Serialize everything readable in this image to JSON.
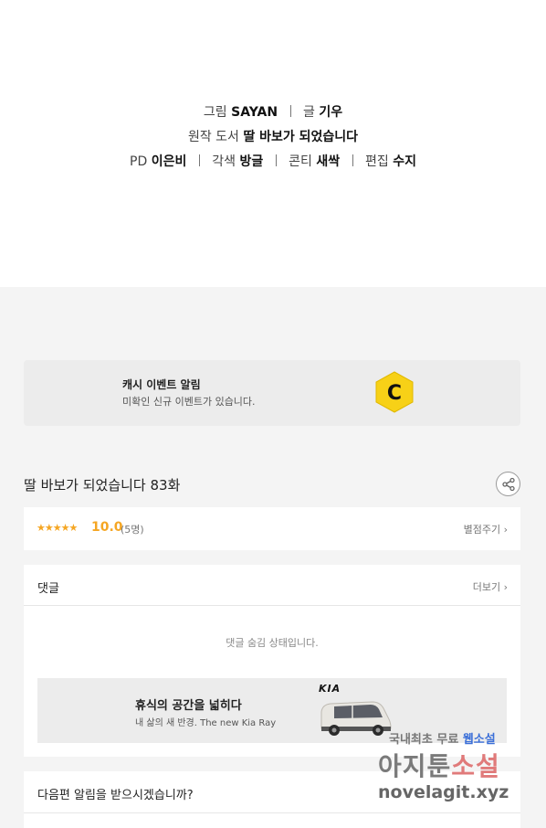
{
  "credits": {
    "art_label": "그림",
    "art_value": "SAYAN",
    "story_label": "글",
    "story_value": "기우",
    "original_label": "원작 도서",
    "original_value": "딸 바보가 되었습니다",
    "pd_label": "PD",
    "pd_value": "이은비",
    "adapt_label": "각색",
    "adapt_value": "방글",
    "storyboard_label": "콘티",
    "storyboard_value": "새싹",
    "edit_label": "편집",
    "edit_value": "수지"
  },
  "event_banner": {
    "title": "캐시 이벤트 알림",
    "subtitle": "미확인 신규 이벤트가 있습니다.",
    "icon": "cash-coin-icon",
    "coin_letter": "C",
    "coin_color": "#f7d117"
  },
  "episode": {
    "title": "딸 바보가 되었습니다 83화",
    "share_icon": "share-icon"
  },
  "rating": {
    "stars": "★★★★★",
    "score": 10.0,
    "score_text": "10.0",
    "count_text": "(5명)",
    "rate_label": "별점주기",
    "star_color": "#f5a623"
  },
  "comments": {
    "title": "댓글",
    "more_label": "더보기",
    "hidden_message": "댓글 숨김 상태입니다."
  },
  "ad": {
    "headline": "휴식의 공간을 넓히다",
    "subline": "내 삶의 새 반경. The new Kia Ray",
    "brand": "KIA"
  },
  "notify": {
    "title": "다음편 알림을 받으시겠습니까?"
  },
  "watermark": {
    "line1_prefix": "국내최초 무료 ",
    "line1_highlight": "웹소설",
    "line2_prefix": "아지툰",
    "line2_highlight": "소설",
    "line3": "novelagit.xyz"
  }
}
